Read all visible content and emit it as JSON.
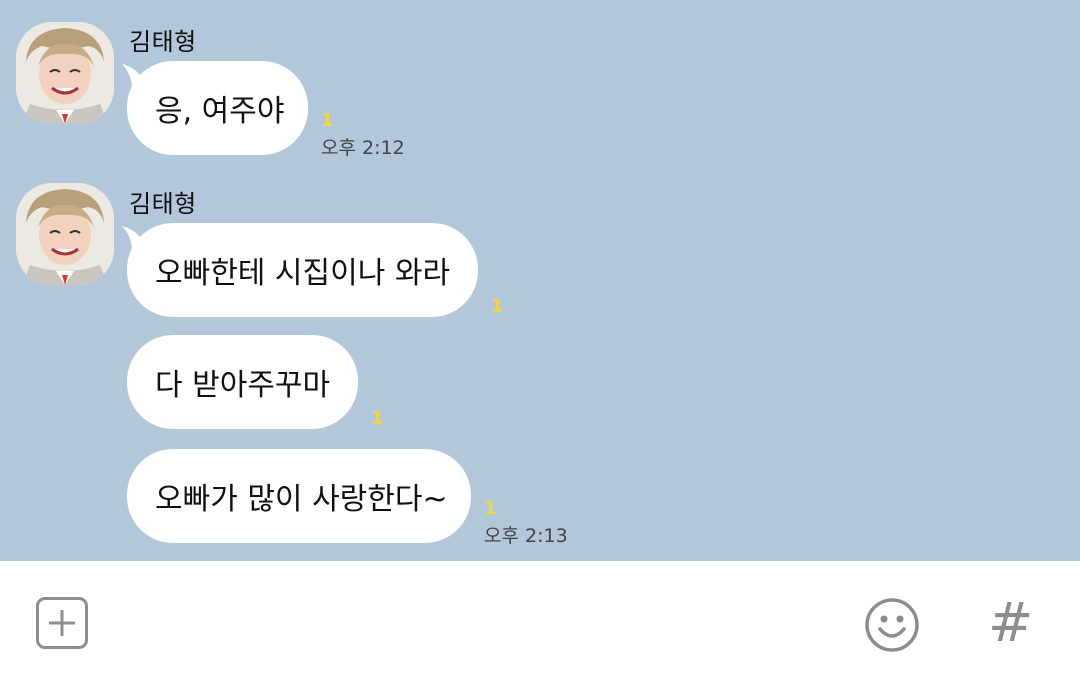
{
  "messages": {
    "group1": {
      "sender": "김태형",
      "bubbles": [
        {
          "text": "응, 여주야",
          "unread": "1",
          "time": "오후 2:12"
        }
      ]
    },
    "group2": {
      "sender": "김태형",
      "bubbles": [
        {
          "text": "오빠한테 시집이나 와라",
          "unread": "1"
        },
        {
          "text": "다 받아주꾸마",
          "unread": "1"
        },
        {
          "text": "오빠가 많이 사랑한다~",
          "unread": "1",
          "time": "오후 2:13"
        }
      ]
    }
  },
  "input_bar": {
    "plus_icon": "plus-icon",
    "emoji_icon": "emoticon-icon",
    "hash_label": "#"
  },
  "colors": {
    "chat_background": "#b2c7da",
    "bubble": "#ffffff",
    "unread_count": "#f1d640"
  }
}
